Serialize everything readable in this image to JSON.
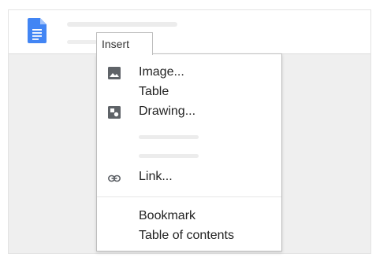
{
  "menu": {
    "tab_label": "Insert",
    "items": [
      {
        "label": "Image...",
        "icon": "image-icon"
      },
      {
        "label": "Table",
        "icon": null
      },
      {
        "label": "Drawing...",
        "icon": "drawing-icon"
      },
      {
        "label": "Link...",
        "icon": "link-icon"
      },
      {
        "label": "Bookmark",
        "icon": null
      },
      {
        "label": "Table of contents",
        "icon": null
      }
    ]
  },
  "colors": {
    "docs_blue": "#4285f4",
    "icon_gray": "#5f6368",
    "placeholder": "#ececec"
  }
}
